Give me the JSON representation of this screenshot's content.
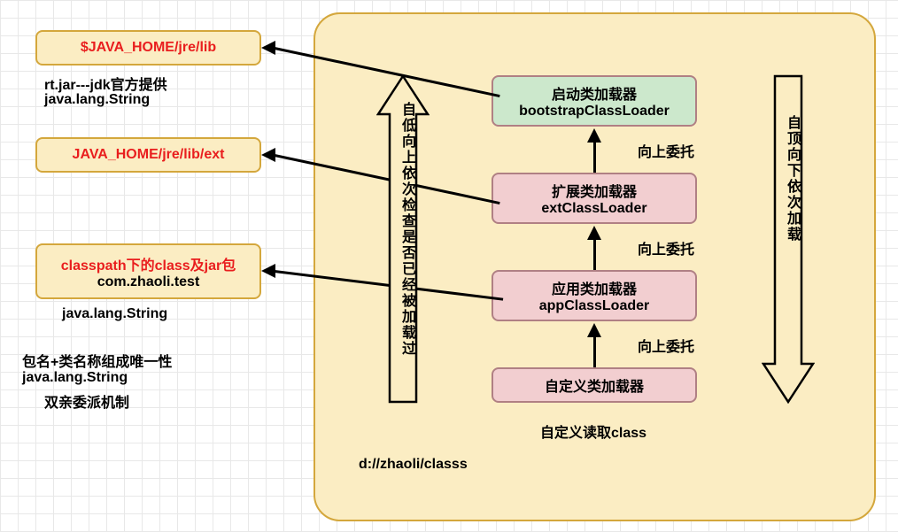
{
  "leftBoxes": {
    "box1": "$JAVA_HOME/jre/lib",
    "box1_sub1": "rt.jar---jdk官方提供",
    "box1_sub2": "java.lang.String",
    "box2": "JAVA_HOME/jre/lib/ext",
    "box3": "classpath下的class及jar包",
    "box3_sub": "com.zhaoli.test",
    "box3_sub2": "java.lang.String",
    "note1": "包名+类名称组成唯一性",
    "note2": "java.lang.String",
    "note3": "双亲委派机制"
  },
  "loaders": {
    "bootstrap_line1": "启动类加载器",
    "bootstrap_line2": "bootstrapClassLoader",
    "ext_line1": "扩展类加载器",
    "ext_line2": "extClassLoader",
    "app_line1": "应用类加载器",
    "app_line2": "appClassLoader",
    "custom_line1": "自定义类加载器"
  },
  "labels": {
    "delegate": "向上委托",
    "custom_read": "自定义读取class",
    "path": "d://zhaoli/classs",
    "up_arrow": "自低向上依次检查是否已经被加载过",
    "down_arrow": "自顶向下依次加载"
  }
}
